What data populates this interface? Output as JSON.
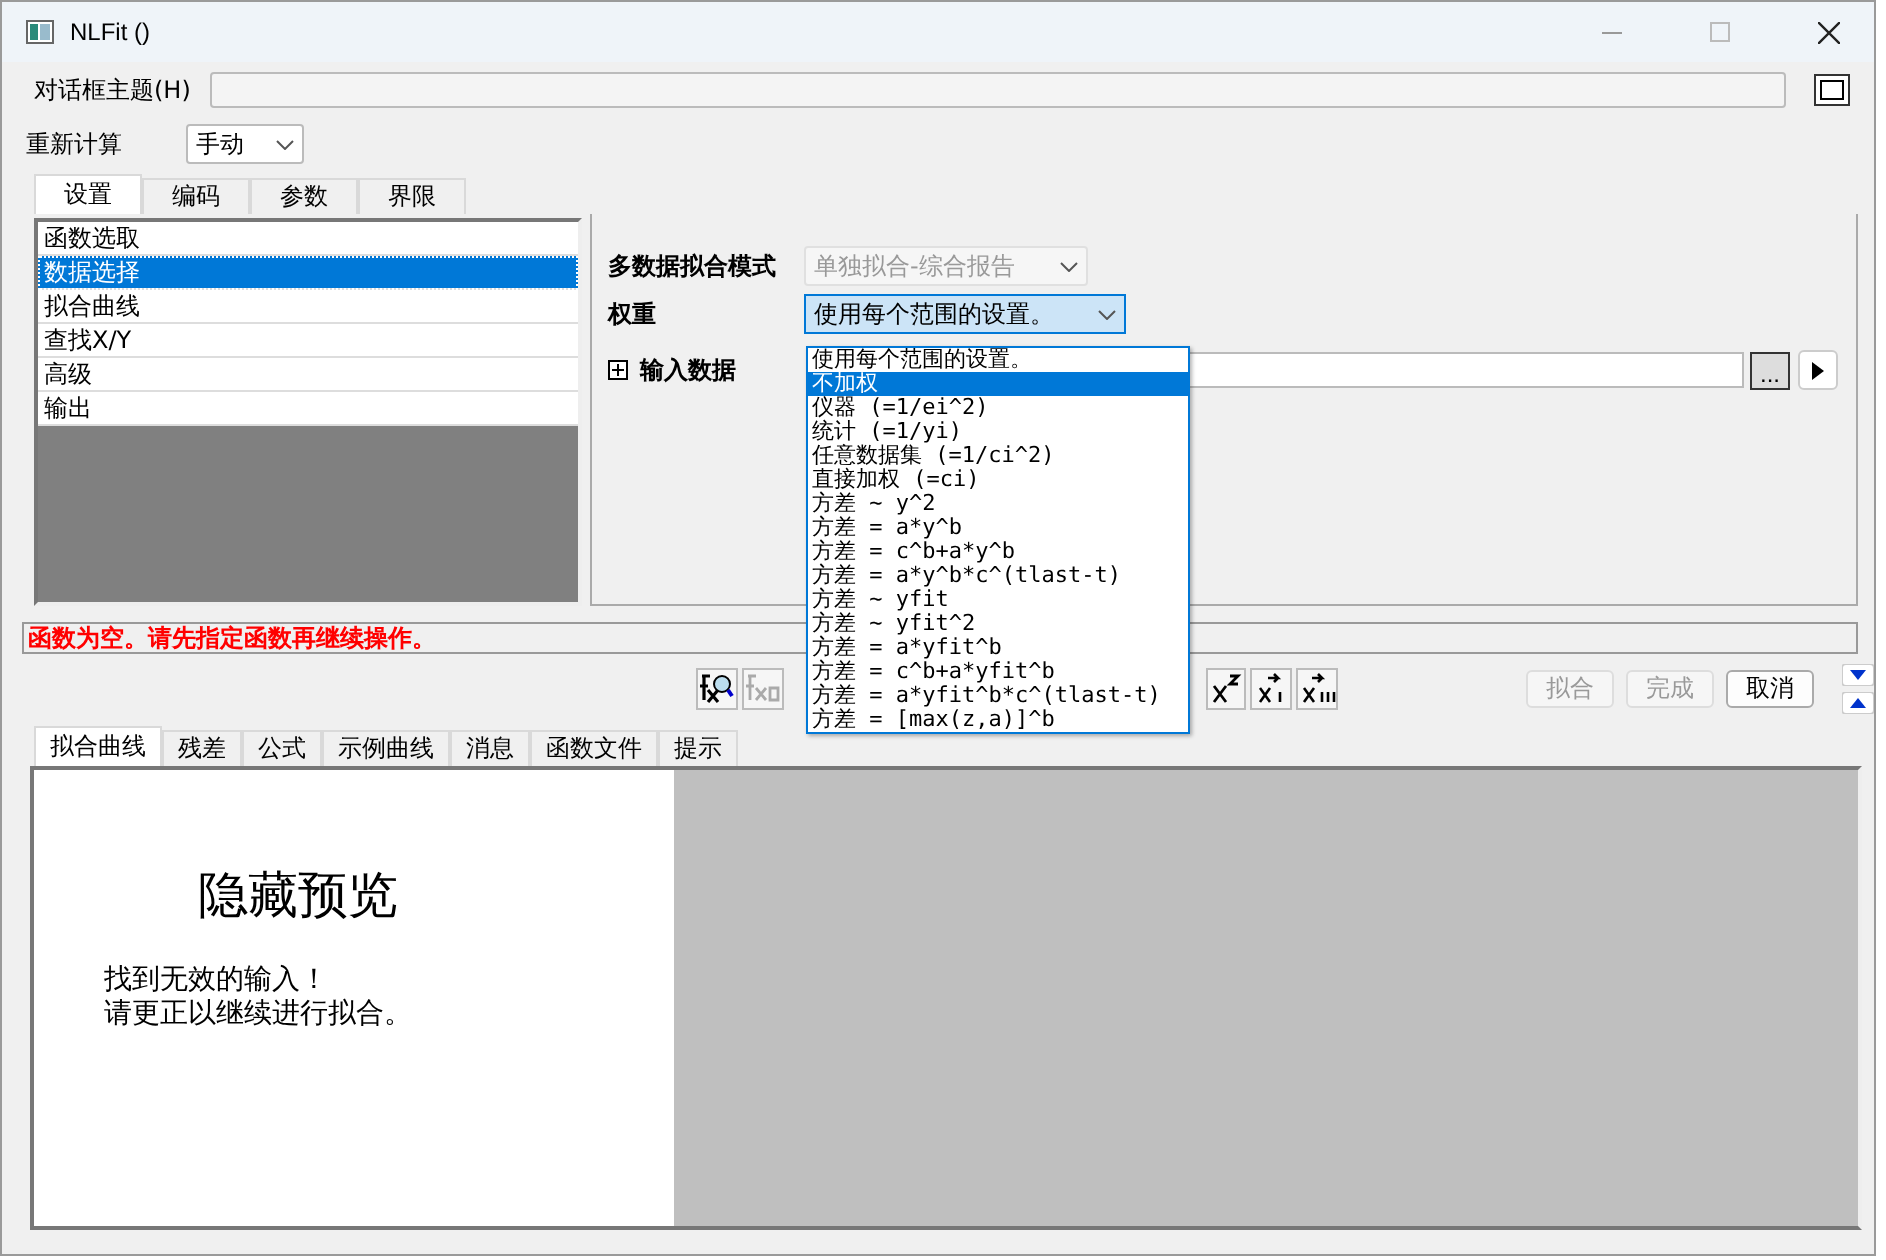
{
  "window": {
    "title": "NLFit ()"
  },
  "dialog_theme": {
    "label": "对话框主题(H)"
  },
  "recalculate": {
    "label": "重新计算",
    "value": "手动"
  },
  "top_tabs": [
    {
      "label": "设置",
      "selected": true
    },
    {
      "label": "编码",
      "selected": false
    },
    {
      "label": "参数",
      "selected": false
    },
    {
      "label": "界限",
      "selected": false
    }
  ],
  "settings_list": [
    {
      "label": "函数选取",
      "selected": false
    },
    {
      "label": "数据选择",
      "selected": true
    },
    {
      "label": "拟合曲线",
      "selected": false
    },
    {
      "label": "查找X/Y",
      "selected": false
    },
    {
      "label": "高级",
      "selected": false
    },
    {
      "label": "输出",
      "selected": false
    }
  ],
  "multi_data_mode": {
    "label": "多数据拟合模式",
    "value": "单独拟合-综合报告",
    "disabled": true
  },
  "weight": {
    "label": "权重",
    "value": "使用每个范围的设置。",
    "expanded": true
  },
  "input_data": {
    "label": "输入数据",
    "expanded": false,
    "browse": "..."
  },
  "weight_options": [
    {
      "label": "使用每个范围的设置。",
      "selected": false
    },
    {
      "label": "不加权",
      "selected": true
    },
    {
      "label": "仪器 (=1/ei^2)",
      "selected": false
    },
    {
      "label": "统计 (=1/yi)",
      "selected": false
    },
    {
      "label": "任意数据集 (=1/ci^2)",
      "selected": false
    },
    {
      "label": "直接加权 (=ci)",
      "selected": false
    },
    {
      "label": "方差 ~ y^2",
      "selected": false
    },
    {
      "label": "方差 = a*y^b",
      "selected": false
    },
    {
      "label": "方差 = c^b+a*y^b",
      "selected": false
    },
    {
      "label": "方差 = a*y^b*c^(tlast-t)",
      "selected": false
    },
    {
      "label": "方差 ~ yfit",
      "selected": false
    },
    {
      "label": "方差 ~ yfit^2",
      "selected": false
    },
    {
      "label": "方差 = a*yfit^b",
      "selected": false
    },
    {
      "label": "方差 = c^b+a*yfit^b",
      "selected": false
    },
    {
      "label": "方差 = a*yfit^b*c^(tlast-t)",
      "selected": false
    },
    {
      "label": "方差 = [max(z,a)]^b",
      "selected": false
    }
  ],
  "error_message": "函数为空。请先指定函数再继续操作。",
  "toolbar_left": [
    {
      "kind": "find",
      "disabled": false
    },
    {
      "kind": "function",
      "disabled": true
    }
  ],
  "toolbar_right": [
    {
      "kind": "square",
      "disabled": false
    },
    {
      "kind": "step",
      "disabled": false
    },
    {
      "kind": "multistep",
      "disabled": false
    }
  ],
  "action_buttons": [
    {
      "label": "拟合",
      "disabled": true
    },
    {
      "label": "完成",
      "disabled": true
    },
    {
      "label": "取消",
      "disabled": false
    }
  ],
  "result_tabs": [
    {
      "label": "拟合曲线",
      "selected": true
    },
    {
      "label": "残差",
      "selected": false
    },
    {
      "label": "公式",
      "selected": false
    },
    {
      "label": "示例曲线",
      "selected": false
    },
    {
      "label": "消息",
      "selected": false
    },
    {
      "label": "函数文件",
      "selected": false
    },
    {
      "label": "提示",
      "selected": false
    }
  ],
  "preview": {
    "title": "隐藏预览",
    "lines": [
      "找到无效的输入！",
      "请更正以继续进行拟合。"
    ]
  }
}
